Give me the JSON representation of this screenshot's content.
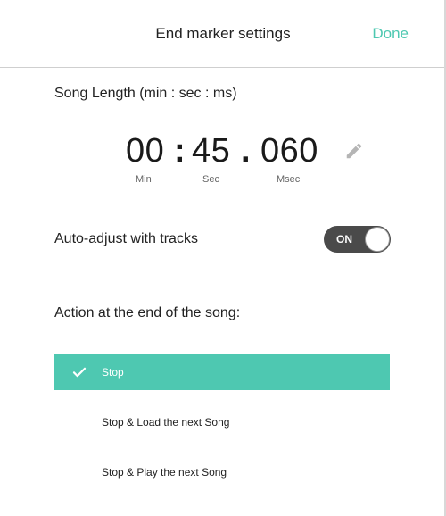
{
  "header": {
    "title": "End marker settings",
    "done_label": "Done"
  },
  "song_length": {
    "label": "Song Length (min : sec : ms)",
    "minutes": "00",
    "seconds": "45",
    "milliseconds": "060",
    "sep_min_sec": ":",
    "sep_sec_ms": ".",
    "unit_min": "Min",
    "unit_sec": "Sec",
    "unit_ms": "Msec",
    "edit_icon": "pencil-icon"
  },
  "auto_adjust": {
    "label": "Auto-adjust with tracks",
    "toggle_state": "ON"
  },
  "end_action": {
    "label": "Action at the end of the song:",
    "options": [
      {
        "label": "Stop",
        "selected": true
      },
      {
        "label": "Stop & Load the next Song",
        "selected": false
      },
      {
        "label": "Stop & Play the next Song",
        "selected": false
      }
    ]
  },
  "colors": {
    "accent": "#4ec8b1",
    "toggle_bg": "#4a4a4a"
  }
}
